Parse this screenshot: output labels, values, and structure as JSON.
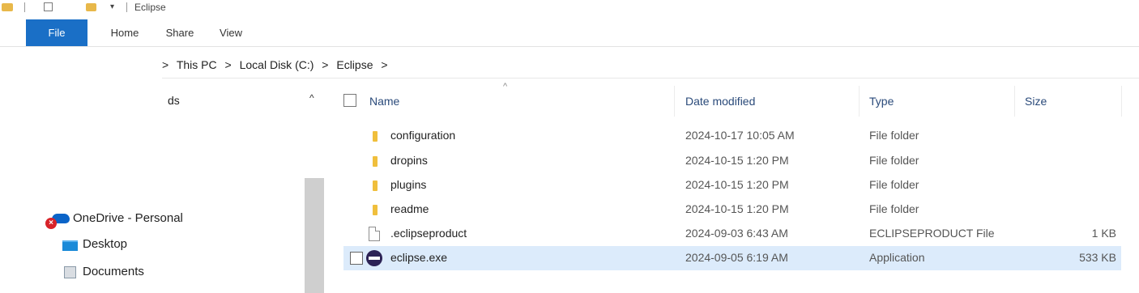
{
  "window": {
    "title": "Eclipse"
  },
  "quick_access": {
    "arrow": "▾"
  },
  "ribbon": {
    "tabs": [
      "File",
      "Home",
      "Share",
      "View"
    ]
  },
  "address": {
    "crumbs": [
      "This PC",
      "Local Disk (C:)",
      "Eclipse"
    ],
    "separator": ">"
  },
  "nav": {
    "quick_access_partial": "ds",
    "scroll_up": "^",
    "items": [
      "OneDrive - Personal",
      "Desktop",
      "Documents"
    ]
  },
  "file_list": {
    "columns": {
      "name": "Name",
      "date": "Date modified",
      "type": "Type",
      "size": "Size"
    },
    "sort_indicator": "^",
    "rows": [
      {
        "name": "configuration",
        "date": "2024-10-17 10:05 AM",
        "type": "File folder",
        "size": "",
        "icon": "folder-icon"
      },
      {
        "name": "dropins",
        "date": "2024-10-15 1:20 PM",
        "type": "File folder",
        "size": "",
        "icon": "folder-icon"
      },
      {
        "name": "plugins",
        "date": "2024-10-15 1:20 PM",
        "type": "File folder",
        "size": "",
        "icon": "folder-icon"
      },
      {
        "name": "readme",
        "date": "2024-10-15 1:20 PM",
        "type": "File folder",
        "size": "",
        "icon": "folder-icon"
      },
      {
        "name": ".eclipseproduct",
        "date": "2024-09-03 6:43 AM",
        "type": "ECLIPSEPRODUCT File",
        "size": "1 KB",
        "icon": "file-icon"
      },
      {
        "name": "eclipse.exe",
        "date": "2024-09-05 6:19 AM",
        "type": "Application",
        "size": "533 KB",
        "icon": "eclipse-app-icon",
        "selected": true
      }
    ]
  },
  "colors": {
    "file_tab": "#1a6fc6",
    "selection": "#dcebfb",
    "folder": "#f0bf3c"
  }
}
